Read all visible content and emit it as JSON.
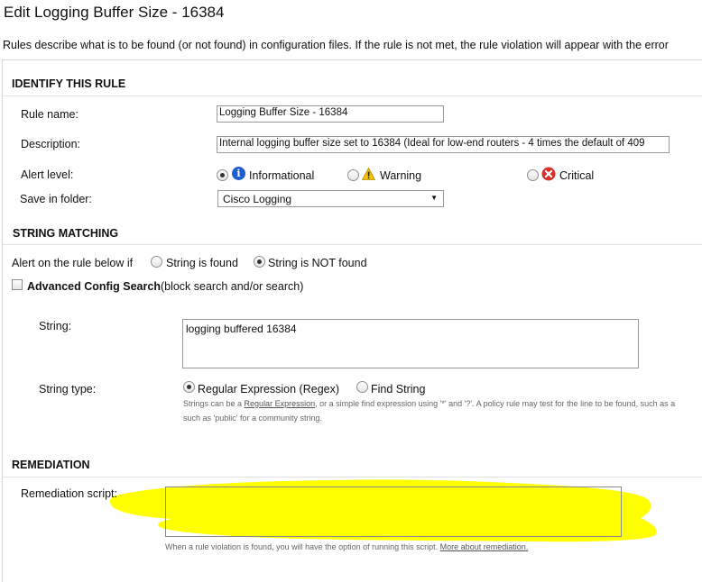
{
  "page": {
    "title": "Edit Logging Buffer Size - 16384",
    "intro": "Rules describe what is to be found (or not found) in configuration files. If the rule is not met, the rule violation will appear with the error"
  },
  "identify": {
    "heading": "IDENTIFY THIS RULE",
    "rule_name_label": "Rule name:",
    "rule_name_value": "Logging Buffer Size - 16384",
    "description_label": "Description:",
    "description_value": "Internal logging buffer size set to 16384 (Ideal for low-end routers - 4 times the default of 409",
    "alert_level_label": "Alert level:",
    "alert_options": [
      "Informational",
      "Warning",
      "Critical"
    ],
    "alert_selected": "Informational",
    "folder_label": "Save in folder:",
    "folder_value": "Cisco Logging"
  },
  "matching": {
    "heading": "STRING MATCHING",
    "alert_prefix": "Alert on the rule below if",
    "option_found": "String is found",
    "option_not_found": "String is NOT found",
    "selected": "String is NOT found",
    "advanced_bold": "Advanced Config Search",
    "advanced_rest": "(block search and/or search)",
    "advanced_checked": false,
    "string_label": "String:",
    "string_value": "logging buffered 16384",
    "string_type_label": "String type:",
    "type_regex": "Regular Expression (Regex)",
    "type_find": "Find String",
    "type_selected": "Regular Expression (Regex)",
    "help_part1": "Strings can be a ",
    "help_link": "Regular Expression",
    "help_part2": ", or a simple find expression using '*' and '?'. A policy rule may test for the line to be found, such as a",
    "help_line2": "such as 'public' for a community string."
  },
  "remediation": {
    "heading": "REMEDIATION",
    "script_label": "Remediation script:",
    "note": "When a rule violation is found, you will have the option of running this script. ",
    "note_link": "More about remediation."
  },
  "colors": {
    "highlight": "#ffff00",
    "info_icon": "#1d5fd1",
    "warning_icon": "#f5c400",
    "critical_icon": "#d9302a"
  }
}
